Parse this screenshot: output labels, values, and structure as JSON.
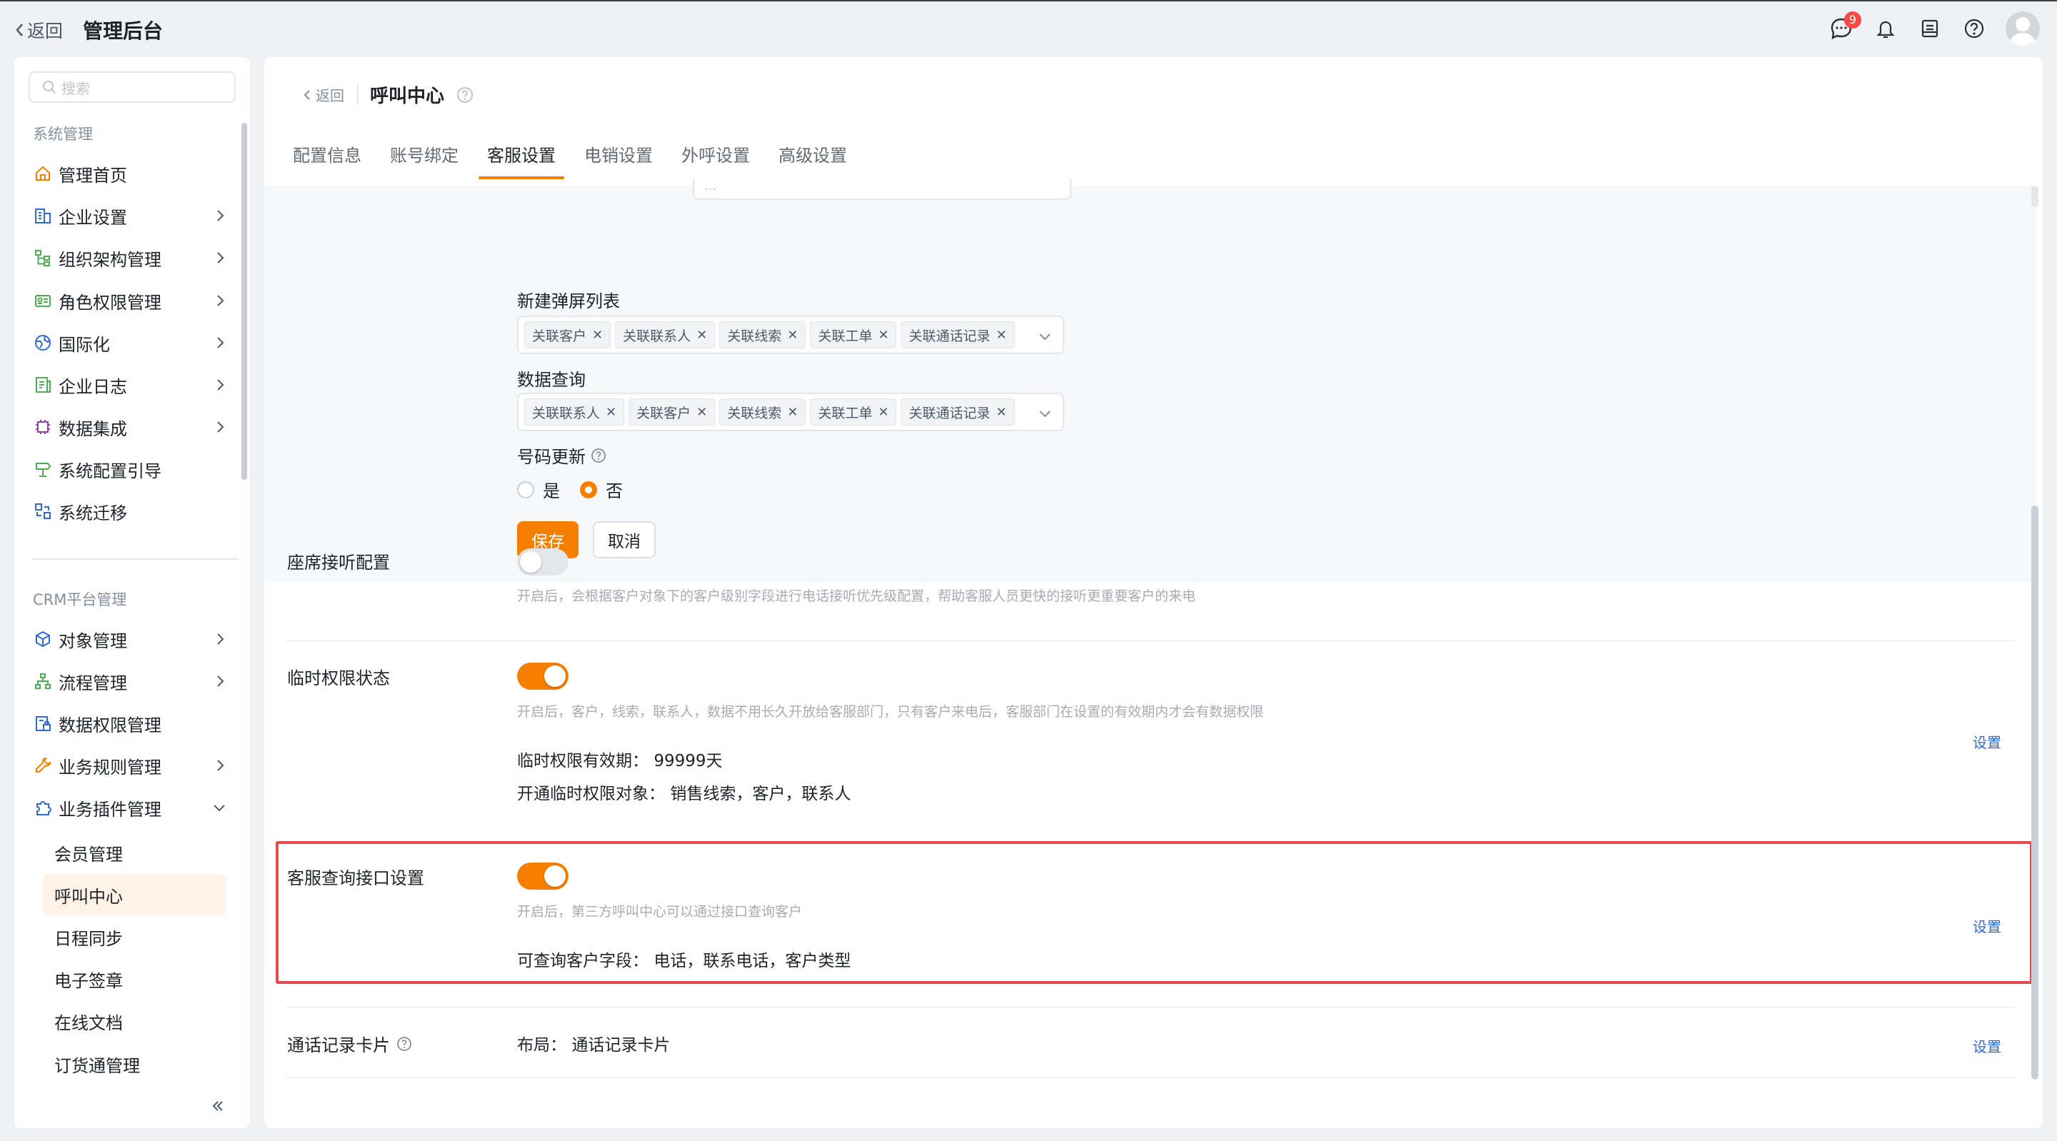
{
  "topbar": {
    "back_label": "返回",
    "app_title": "管理后台",
    "message_badge": "9",
    "icons": [
      "message-icon",
      "bell-icon",
      "notes-icon",
      "help-icon",
      "avatar"
    ]
  },
  "sidebar": {
    "search_placeholder": "搜索",
    "group1_title": "系统管理",
    "group1_items": [
      {
        "label": "管理首页",
        "icon": "home-icon",
        "chevron": false
      },
      {
        "label": "企业设置",
        "icon": "building-icon",
        "chevron": true
      },
      {
        "label": "组织架构管理",
        "icon": "org-icon",
        "chevron": true
      },
      {
        "label": "角色权限管理",
        "icon": "id-card-icon",
        "chevron": true
      },
      {
        "label": "国际化",
        "icon": "globe-icon",
        "chevron": true
      },
      {
        "label": "企业日志",
        "icon": "log-icon",
        "chevron": true
      },
      {
        "label": "数据集成",
        "icon": "chip-icon",
        "chevron": true
      },
      {
        "label": "系统配置引导",
        "icon": "guide-icon",
        "chevron": false
      },
      {
        "label": "系统迁移",
        "icon": "migrate-icon",
        "chevron": false
      }
    ],
    "group2_title": "CRM平台管理",
    "group2_items": [
      {
        "label": "对象管理",
        "icon": "cube-icon",
        "chevron": true
      },
      {
        "label": "流程管理",
        "icon": "flow-icon",
        "chevron": true
      },
      {
        "label": "数据权限管理",
        "icon": "data-lock-icon",
        "chevron": false
      },
      {
        "label": "业务规则管理",
        "icon": "wrench-icon",
        "chevron": true
      },
      {
        "label": "业务插件管理",
        "icon": "puzzle-icon",
        "chevron": "down"
      }
    ],
    "sub_items": [
      "会员管理",
      "呼叫中心",
      "日程同步",
      "电子签章",
      "在线文档",
      "订货通管理"
    ],
    "active_sub": "呼叫中心"
  },
  "main": {
    "back_label": "返回",
    "page_title": "呼叫中心",
    "tabs": [
      "配置信息",
      "账号绑定",
      "客服设置",
      "电销设置",
      "外呼设置",
      "高级设置"
    ],
    "active_tab": "客服设置",
    "stub_value": "...",
    "popup_list": {
      "label": "新建弹屏列表",
      "tags": [
        "关联客户",
        "关联联系人",
        "关联线索",
        "关联工单",
        "关联通话记录"
      ]
    },
    "data_query": {
      "label": "数据查询",
      "tags": [
        "关联联系人",
        "关联客户",
        "关联线索",
        "关联工单",
        "关联通话记录"
      ]
    },
    "number_update": {
      "label": "号码更新",
      "options": [
        "是",
        "否"
      ],
      "selected": "否"
    },
    "save_label": "保存",
    "cancel_label": "取消",
    "seat_listen": {
      "label": "座席接听配置",
      "enabled": false,
      "hint": "开启后，会根据客户对象下的客户级别字段进行电话接听优先级配置，帮助客服人员更快的接听更重要客户的来电"
    },
    "temp_permission": {
      "label": "临时权限状态",
      "enabled": true,
      "hint": "开启后，客户，线索，联系人，数据不用长久开放给客服部门，只有客户来电后，客服部门在设置的有效期内才会有数据权限",
      "validity_label": "临时权限有效期：",
      "validity_value": "99999天",
      "objects_label": "开通临时权限对象：",
      "objects_value": "销售线索，客户，联系人",
      "set_label": "设置"
    },
    "query_api": {
      "label": "客服查询接口设置",
      "enabled": true,
      "hint": "开启后，第三方呼叫中心可以通过接口查询客户",
      "fields_label": "可查询客户字段：",
      "fields_value": "电话，联系电话，客户类型",
      "set_label": "设置"
    },
    "call_card": {
      "label": "通话记录卡片",
      "layout_label": "布局：",
      "layout_value": "通话记录卡片",
      "set_label": "设置"
    }
  },
  "colors": {
    "accent": "#f77f00",
    "link": "#2f6bd8",
    "highlight_border": "#e54a4f",
    "badge": "#f54a45"
  }
}
